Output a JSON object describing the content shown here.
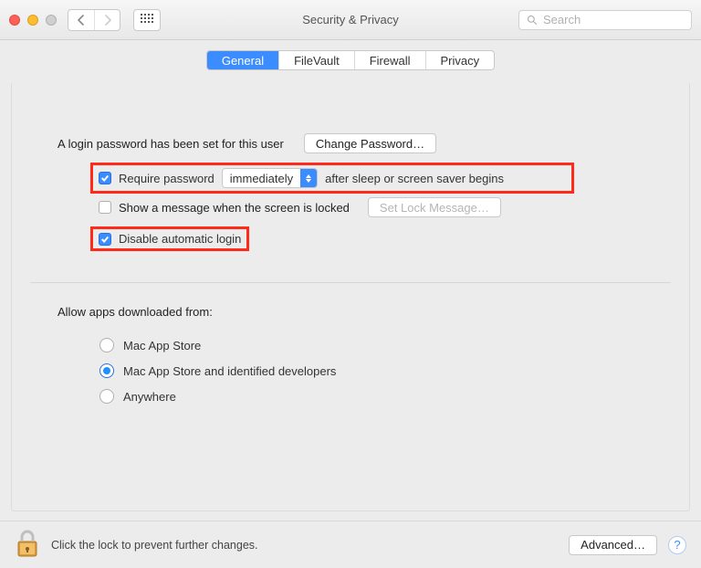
{
  "window": {
    "title": "Security & Privacy",
    "search_placeholder": "Search"
  },
  "tabs": [
    {
      "label": "General",
      "selected": true
    },
    {
      "label": "FileVault",
      "selected": false
    },
    {
      "label": "Firewall",
      "selected": false
    },
    {
      "label": "Privacy",
      "selected": false
    }
  ],
  "login": {
    "password_set_text": "A login password has been set for this user",
    "change_password_btn": "Change Password…",
    "require_password_label": "Require password",
    "delay_selected": "immediately",
    "after_sleep_text": "after sleep or screen saver begins",
    "show_message_label": "Show a message when the screen is locked",
    "set_lock_message_btn": "Set Lock Message…",
    "disable_auto_login_label": "Disable automatic login",
    "require_password_checked": true,
    "show_message_checked": false,
    "disable_auto_login_checked": true
  },
  "gatekeeper": {
    "heading": "Allow apps downloaded from:",
    "options": [
      {
        "label": "Mac App Store",
        "selected": false
      },
      {
        "label": "Mac App Store and identified developers",
        "selected": true
      },
      {
        "label": "Anywhere",
        "selected": false
      }
    ]
  },
  "footer": {
    "lock_text": "Click the lock to prevent further changes.",
    "advanced_btn": "Advanced…"
  }
}
